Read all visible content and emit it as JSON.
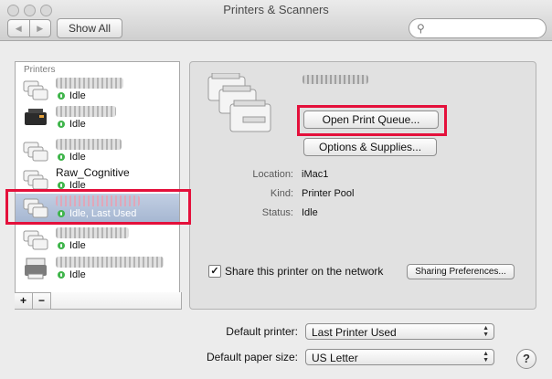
{
  "window": {
    "title": "Printers & Scanners"
  },
  "toolbar": {
    "back_icon": "chevron-left-icon",
    "forward_icon": "chevron-right-icon",
    "show_all": "Show All",
    "search_placeholder": ""
  },
  "printers": {
    "header": "Printers",
    "items": [
      {
        "name": "",
        "status": "Idle",
        "selected": false
      },
      {
        "name": "",
        "status": "Idle",
        "selected": false
      },
      {
        "name": "",
        "status": "Idle",
        "selected": false
      },
      {
        "name": "Raw_Cognitive",
        "status": "Idle",
        "selected": false
      },
      {
        "name": "",
        "status": "Idle, Last Used",
        "selected": true
      },
      {
        "name": "",
        "status": "Idle",
        "selected": false
      },
      {
        "name": "",
        "status": "Idle",
        "selected": false
      }
    ],
    "add": "+",
    "remove": "−"
  },
  "detail": {
    "open_queue": "Open Print Queue...",
    "options_supplies": "Options & Supplies...",
    "location_label": "Location:",
    "location_value": "iMac1",
    "kind_label": "Kind:",
    "kind_value": "Printer Pool",
    "status_label": "Status:",
    "status_value": "Idle",
    "share_label": "Share this printer on the network",
    "share_checked": true,
    "sharing_prefs": "Sharing Preferences..."
  },
  "defaults": {
    "printer_label": "Default printer:",
    "printer_value": "Last Printer Used",
    "paper_label": "Default paper size:",
    "paper_value": "US Letter"
  },
  "help": "?",
  "colors": {
    "highlight": "#e4103b",
    "status_dot": "#3fb54b",
    "selection": "#a6b7d2"
  }
}
